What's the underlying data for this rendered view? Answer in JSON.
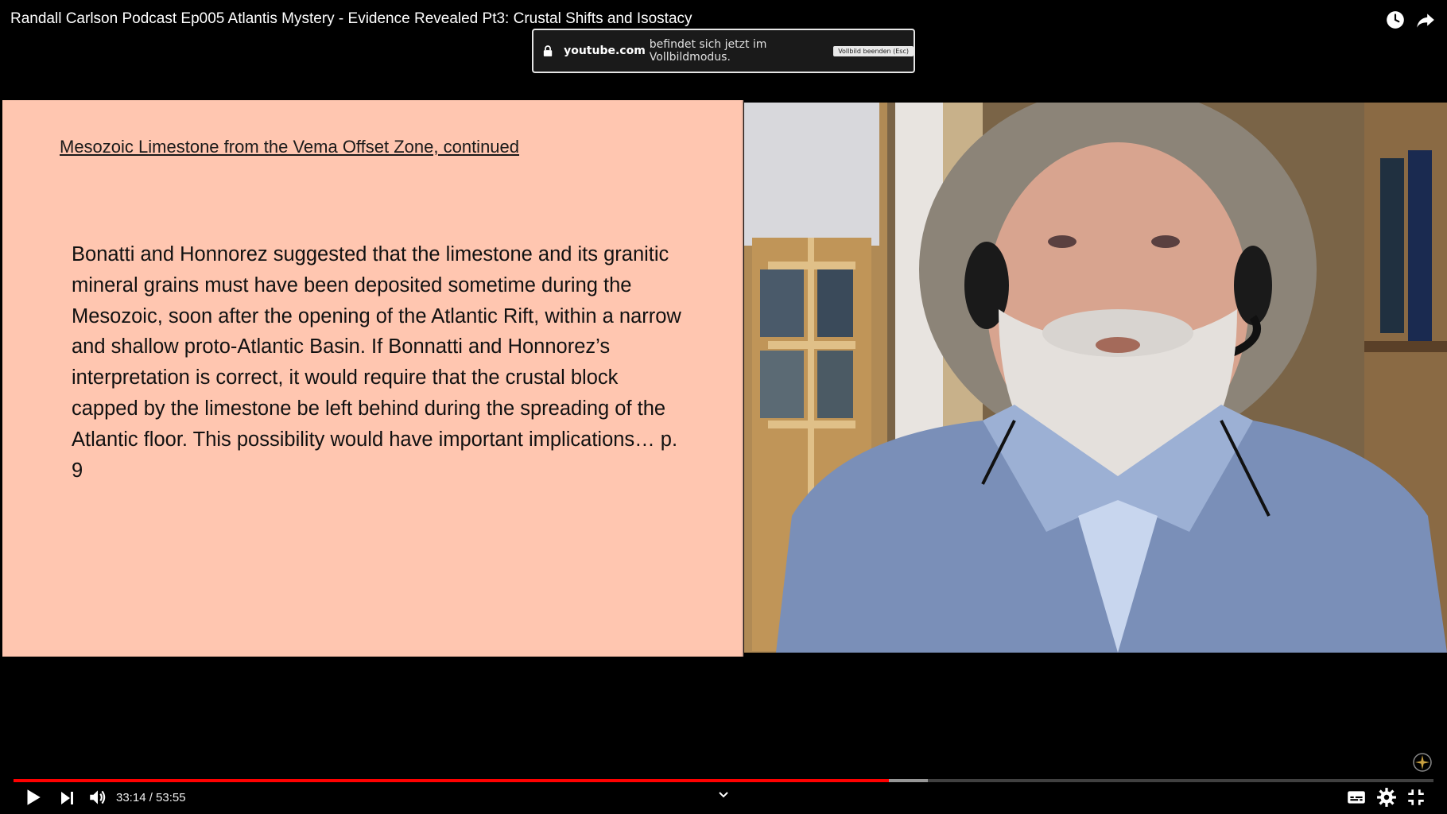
{
  "video": {
    "title": "Randall Carlson Podcast Ep005 Atlantis Mystery - Evidence Revealed Pt3: Crustal Shifts and Isostacy"
  },
  "fullscreen_notice": {
    "domain": "youtube.com",
    "message": "befindet sich jetzt im Vollbildmodus.",
    "exit_label": "Vollbild beenden (Esc)"
  },
  "slide": {
    "heading": "Mesozoic  Limestone from the Vema Offset Zone, continued",
    "body": "Bonatti and Honnorez suggested that the limestone and its granitic mineral grains must have been deposited sometime during the Mesozoic, soon after the opening of the Atlantic Rift, within a narrow and shallow proto-Atlantic Basin. If Bonnatti and Honnorez’s interpretation is correct, it would require that the crustal block capped by the limestone be left behind during the spreading of the Atlantic floor. This possibility would have important implications…  p. 9"
  },
  "controls": {
    "time_display": "33:14 / 53:55",
    "played_fraction": 0.6164,
    "buffered_fraction": 0.6437,
    "icons": {
      "play": "play-icon",
      "next": "next-icon",
      "volume": "volume-icon",
      "chapters": "chevron-down-icon",
      "subtitles": "subtitles-icon",
      "settings": "gear-icon",
      "exit_fullscreen": "exit-fullscreen-icon",
      "watch_later": "clock-icon",
      "share": "share-icon"
    },
    "accent_color": "#ff0000"
  }
}
